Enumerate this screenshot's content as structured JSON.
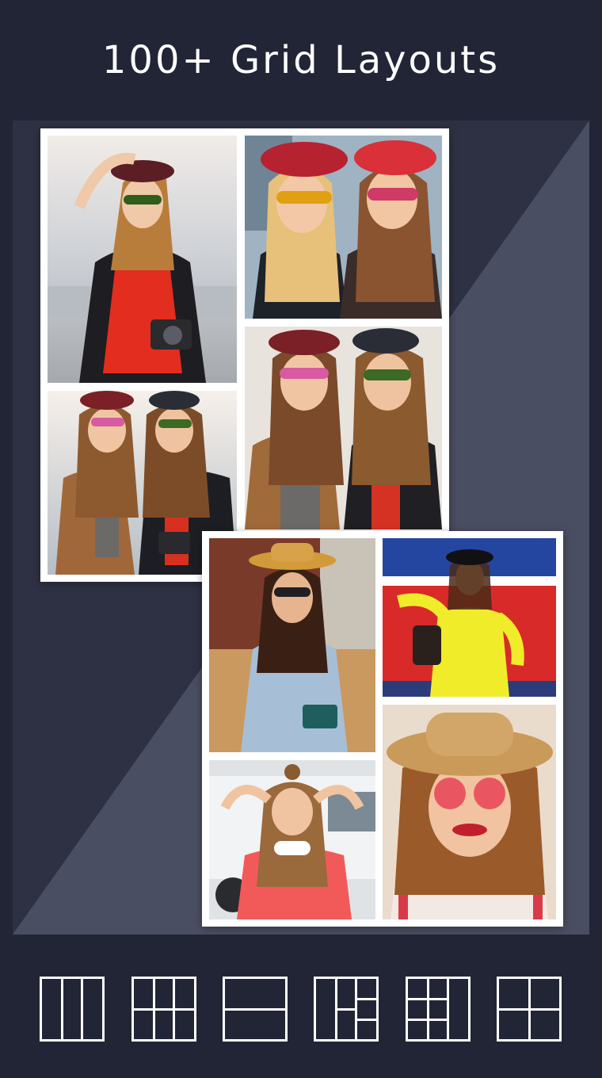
{
  "header": {
    "title": "100+ Grid Layouts"
  },
  "colors": {
    "background": "#222536",
    "stage_dark": "#2d3143",
    "stage_light": "#4a4e62",
    "frame": "#ffffff"
  },
  "collages": [
    {
      "name": "collage-top-left",
      "photos": [
        "photo-girl-red-shirt-camera",
        "photo-two-girls-floral-caps",
        "photo-two-girls-sunglasses-closeup",
        "photo-two-girls-rooftop"
      ]
    },
    {
      "name": "collage-bottom-right",
      "photos": [
        "photo-girl-straw-hat-blue-dress",
        "photo-girl-yellow-sweater-flag",
        "photo-girl-headphones-car",
        "photo-girl-red-sunglasses-hat"
      ]
    }
  ],
  "layout_options": [
    {
      "icon": "three-columns-icon"
    },
    {
      "icon": "six-grid-icon"
    },
    {
      "icon": "two-rows-icon"
    },
    {
      "icon": "mixed-grid-icon"
    },
    {
      "icon": "five-grid-icon"
    },
    {
      "icon": "four-grid-icon"
    }
  ]
}
